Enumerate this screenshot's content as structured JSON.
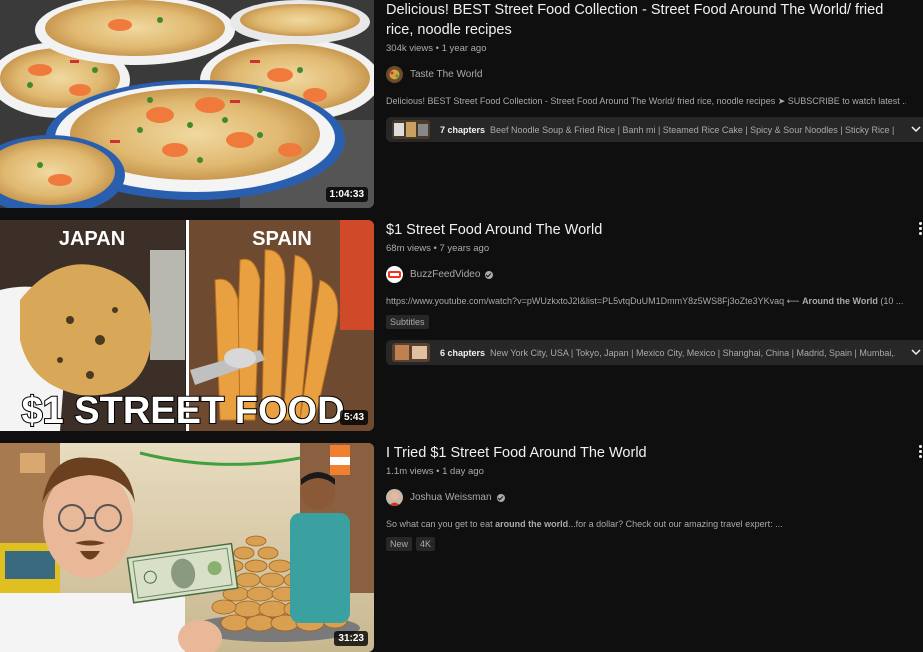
{
  "results": [
    {
      "title": "Delicious! BEST Street Food Collection - Street Food Around The World/ fried rice, noodle recipes",
      "views": "304k views",
      "age": "1 year ago",
      "channel": "Taste The World",
      "description": "Delicious! BEST Street Food Collection - Street Food Around The World/ fried rice, noodle recipes ➤ SUBSCRIBE to watch latest ...",
      "duration": "1:04:33",
      "chapters_count": "7 chapters",
      "chapters_list": "Beef Noodle Soup & Fried Rice | Banh mi | Steamed Rice Cake | Spicy & Sour Noodles | Sticky Rice |..."
    },
    {
      "title": "$1 Street Food Around The World",
      "views": "68m views",
      "age": "7 years ago",
      "channel": "BuzzFeedVideo",
      "description_prefix": "https://www.youtube.com/watch?v=pWUzkxtoJ2I&list=PL5vtqDuUM1DmmY8z5WS8Fj3oZte3YKvaq ⟵ ",
      "description_bold": "Around the World",
      "description_suffix": " (10 ...",
      "badges": [
        "Subtitles"
      ],
      "duration": "5:43",
      "thumb_text_left": "JAPAN",
      "thumb_text_right": "SPAIN",
      "thumb_big_text": "$1 STREET FOOD",
      "chapters_count": "6 chapters",
      "chapters_list": "New York City, USA | Tokyo, Japan | Mexico City, Mexico | Shanghai, China | Madrid, Spain | Mumbai,..."
    },
    {
      "title": "I Tried $1 Street Food Around The World",
      "views": "1.1m views",
      "age": "1 day ago",
      "channel": "Joshua Weissman",
      "description_prefix": "So what can you get to eat ",
      "description_bold": "around the world",
      "description_suffix": "...for a dollar? Check out our amazing travel expert: ...",
      "badges": [
        "New",
        "4K"
      ],
      "duration": "31:23"
    }
  ],
  "colors": {
    "background": "#0f0f0f",
    "text_primary": "#f1f1f1",
    "text_secondary": "#aaaaaa",
    "chip_bg": "#272727"
  }
}
